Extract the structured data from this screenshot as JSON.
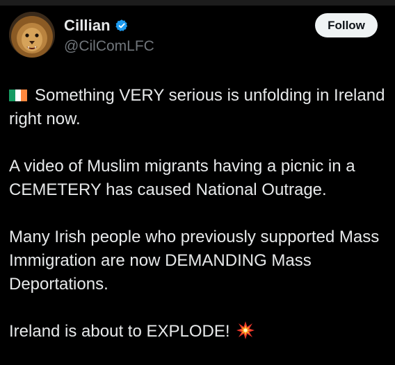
{
  "account": {
    "display_name": "Cillian",
    "handle": "@CilComLFC",
    "verified": true,
    "avatar_icon": "lion-avatar"
  },
  "follow_label": "Follow",
  "tweet": {
    "paragraphs": [
      "Something VERY serious is unfolding in Ireland right now.",
      "A video of Muslim migrants having a picnic in a CEMETERY has caused National Outrage.",
      "Many Irish people who previously supported Mass Immigration are now DEMANDING Mass Deportations.",
      "Ireland is about to EXPLODE!"
    ],
    "leading_emoji": "ireland-flag-icon",
    "trailing_emoji": "explosion-icon"
  },
  "colors": {
    "background": "#000000",
    "text": "#e7e9ea",
    "muted": "#71767b",
    "verified_blue": "#1d9bf0",
    "follow_bg": "#eff3f4",
    "flag_green": "#169b62",
    "flag_white": "#ffffff",
    "flag_orange": "#ff883e"
  }
}
